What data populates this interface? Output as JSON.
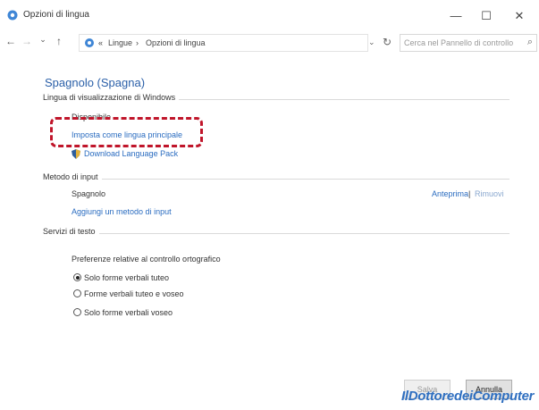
{
  "window": {
    "title": "Opzioni di lingua",
    "minimize": "—",
    "maximize": "☐",
    "close": "✕"
  },
  "address_bar": {
    "back": "←",
    "forward": "→",
    "recent": "⌄",
    "up": "↑",
    "breadcrumb": [
      "«",
      "Lingue",
      "›",
      "Opzioni di lingua"
    ],
    "dropdown": "⌄",
    "refresh": "↻",
    "search_placeholder": "Cerca nel Pannello di controllo"
  },
  "content": {
    "language_title": "Spagnolo (Spagna)",
    "display_section": {
      "label": "Lingua di visualizzazione di Windows",
      "status": "Disponibile",
      "set_primary_link": "Imposta come lingua principale",
      "download_link": "Download Language Pack"
    },
    "input_section": {
      "label": "Metodo di input",
      "method": "Spagnolo",
      "preview_link": "Anteprima",
      "separator": "|",
      "remove_link": "Rimuovi",
      "add_link": "Aggiungi un metodo di input"
    },
    "text_services_section": {
      "label": "Servizi di testo",
      "spellcheck_heading": "Preferenze relative al controllo ortografico",
      "options": [
        {
          "label": "Solo forme verbali tuteo",
          "checked": true
        },
        {
          "label": "Forme verbali tuteo e voseo",
          "checked": false
        },
        {
          "label": "Solo forme verbali voseo",
          "checked": false
        }
      ]
    }
  },
  "footer": {
    "save_label": "Salva",
    "cancel_label": "Annulla"
  },
  "watermark": "IlDottoredeiComputer",
  "colors": {
    "link": "#2a6cc0",
    "title": "#2a5fa8",
    "highlight": "#c0152a"
  }
}
